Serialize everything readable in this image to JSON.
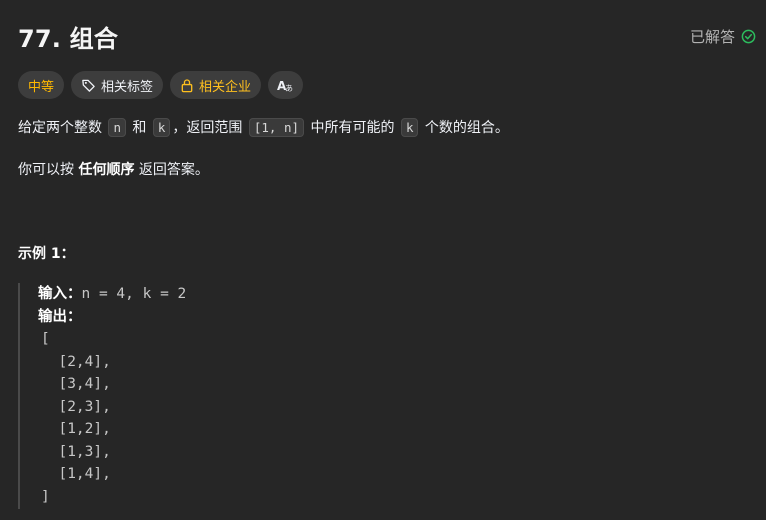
{
  "problem": {
    "title": "77. 组合",
    "status_label": "已解答"
  },
  "tags": {
    "difficulty": "中等",
    "topics": "相关标签",
    "companies": "相关企业",
    "lang_icon_text": "Aあ"
  },
  "description": {
    "p1": {
      "t1": "给定两个整数 ",
      "c1": "n",
      "t2": " 和 ",
      "c2": "k",
      "t3": "，返回范围 ",
      "c3": "[1, n]",
      "t4": " 中所有可能的 ",
      "c4": "k",
      "t5": " 个数的组合。"
    },
    "p2": {
      "t1": "你可以按 ",
      "bold": "任何顺序",
      "t2": " 返回答案。"
    }
  },
  "example": {
    "title": "示例 1：",
    "input_label": "输入：",
    "input_value": "n = 4, k = 2",
    "output_label": "输出：",
    "output_lines": [
      "[",
      "  [2,4],",
      "  [3,4],",
      "  [2,3],",
      "  [1,2],",
      "  [1,3],",
      "  [1,4],",
      "]"
    ]
  },
  "colors": {
    "background": "#262626",
    "difficulty": "#ffb800",
    "company": "#ffc01e",
    "solved_check": "#2cbb5d"
  },
  "icons": {
    "solved": "check-circle-icon",
    "topics": "tag-icon",
    "companies": "lock-icon",
    "lang": "translate-icon"
  }
}
